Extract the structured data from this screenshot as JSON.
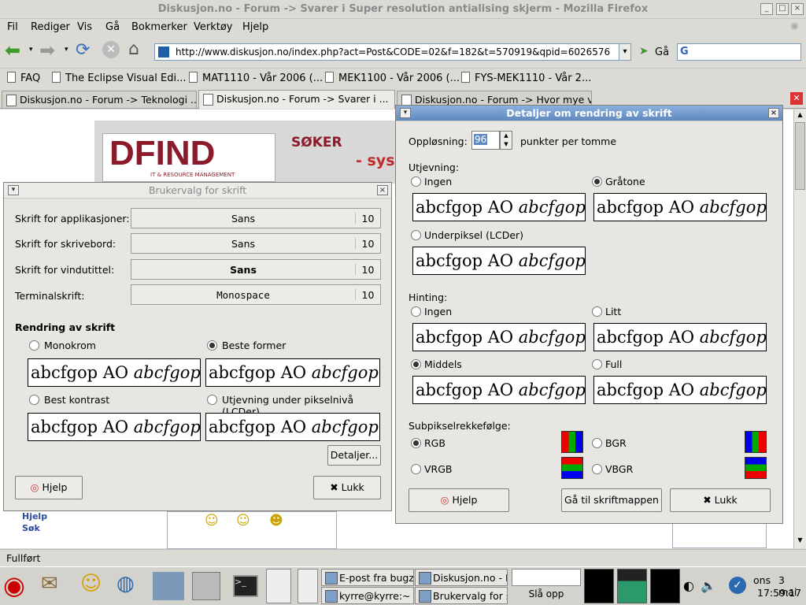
{
  "window": {
    "title": "Diskusjon.no - Forum -> Svarer i Super resolution antialising skjerm - Mozilla Firefox"
  },
  "menu": [
    "Fil",
    "Rediger",
    "Vis",
    "Gå",
    "Bokmerker",
    "Verktøy",
    "Hjelp"
  ],
  "nav": {
    "url": "http://www.diskusjon.no/index.php?act=Post&CODE=02&f=182&t=570919&qpid=6026576",
    "go_label": "Gå"
  },
  "bookmarks": [
    "FAQ",
    "The Eclipse Visual Edi...",
    "MAT1110 - Vår 2006 (...",
    "MEK1100 - Vår 2006 (...",
    "FYS-MEK1110 - Vår 2..."
  ],
  "tabs": [
    "Diskusjon.no - Forum -> Teknologi ...",
    "Diskusjon.no - Forum -> Svarer i ...",
    "Diskusjon.no - Forum -> Hvor mye v..."
  ],
  "page": {
    "logo_text": "DFIND",
    "logo_sub": "IT & RESOURCE MANAGEMENT",
    "banner1": "SØKER",
    "banner2": "- sys",
    "link_help": "Hjelp",
    "link_search": "Søk"
  },
  "status": {
    "text": "Fullført"
  },
  "font_dialog": {
    "title": "Brukervalg for skrift",
    "rows": [
      {
        "label": "Skrift for applikasjoner:",
        "font": "Sans",
        "size": "10"
      },
      {
        "label": "Skrift for skrivebord:",
        "font": "Sans",
        "size": "10"
      },
      {
        "label": "Skrift for vindutittel:",
        "font": "Sans",
        "size": "10"
      },
      {
        "label": "Terminalskrift:",
        "font": "Monospace",
        "size": "10"
      }
    ],
    "rendering_header": "Rendring av skrift",
    "options": [
      "Monokrom",
      "Beste former",
      "Best kontrast",
      "Utjevning under pikselnivå (LCDer)"
    ],
    "sample_plain": "abcfgop AO ",
    "sample_italic": "abcfgop",
    "details_button": "Detaljer...",
    "help_button": "Hjelp",
    "close_button": "Lukk"
  },
  "details_dialog": {
    "title": "Detaljer om rendring av skrift",
    "resolution_label": "Oppløsning:",
    "resolution_value": "96",
    "resolution_unit": "punkter per tomme",
    "smoothing_header": "Utjevning:",
    "smoothing_options": [
      "Ingen",
      "Gråtone",
      "Underpiksel (LCDer)"
    ],
    "hinting_header": "Hinting:",
    "hinting_options": [
      "Ingen",
      "Litt",
      "Middels",
      "Full"
    ],
    "subpixel_header": "Subpikselrekkefølge:",
    "subpixel_options": [
      "RGB",
      "BGR",
      "VRGB",
      "VBGR"
    ],
    "help_button": "Hjelp",
    "folder_button": "Gå til skriftmappen",
    "close_button": "Lukk"
  },
  "taskbar": {
    "tasks": [
      "E-post fra bugzi",
      "Diskusjon.no - F",
      "kyrre@kyrre:~",
      "Brukervalg for s"
    ],
    "slaa": "Slå opp",
    "day": "ons",
    "date": "3 mai",
    "time": "17:59:17"
  },
  "colors": {
    "accent": "#5f89c1",
    "logo_red": "#8b1a2a"
  }
}
